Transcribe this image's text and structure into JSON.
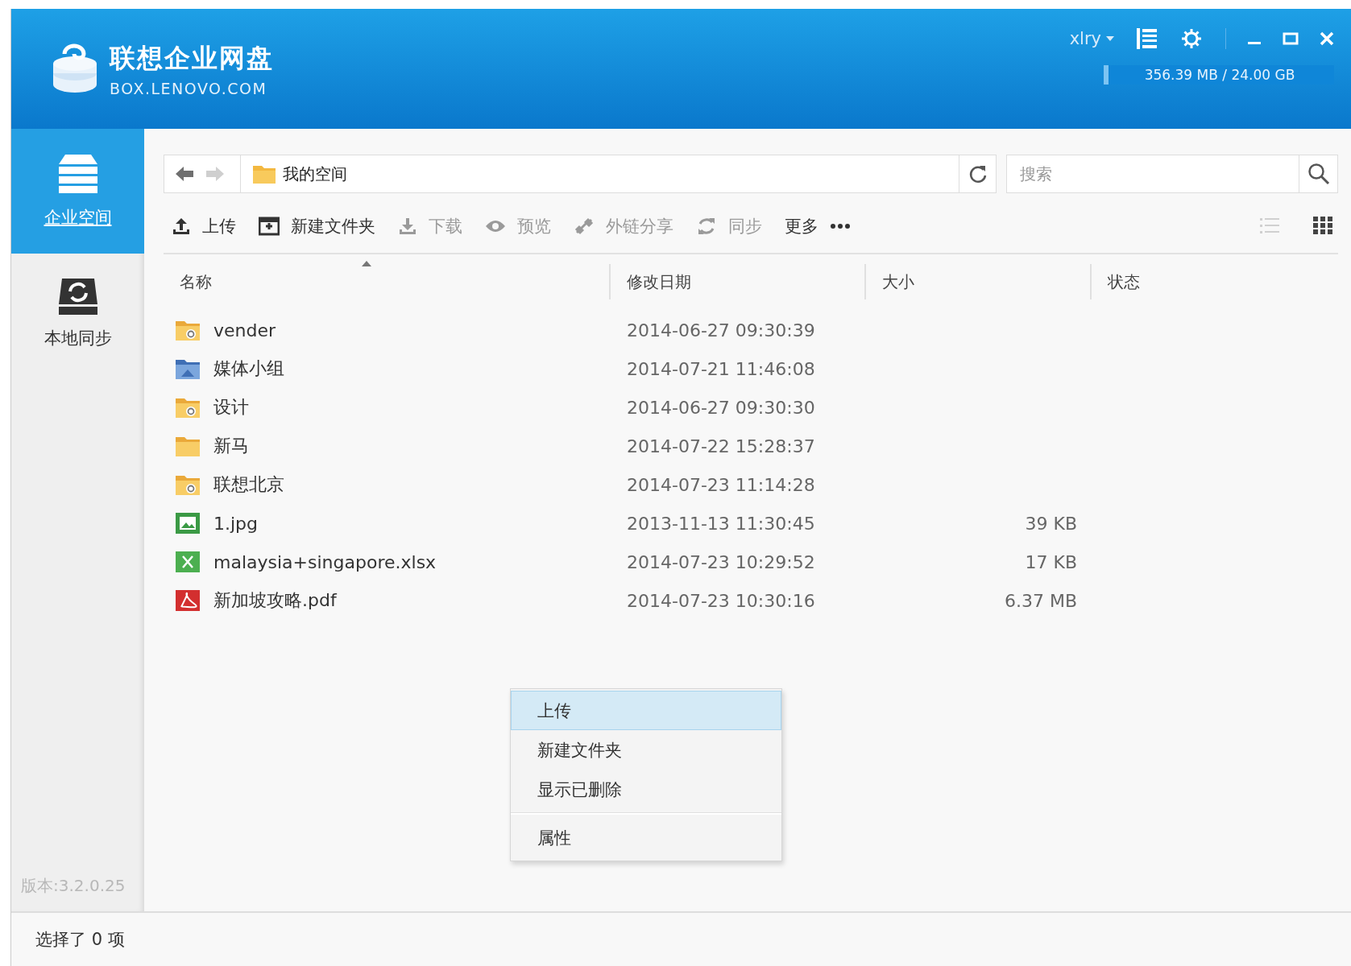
{
  "app": {
    "name": "联想企业网盘",
    "domain": "BOX.LENOVO.COM"
  },
  "user": {
    "name": "xlry"
  },
  "storage": {
    "text": "356.39 MB / 24.00 GB",
    "level": 0.015
  },
  "sidebar": {
    "items": [
      {
        "label": "企业空间",
        "kind": "server",
        "selected": true
      },
      {
        "label": "本地同步",
        "kind": "sync",
        "selected": false
      }
    ],
    "version": "版本:3.2.0.25"
  },
  "address": {
    "path": "我的空间"
  },
  "search": {
    "placeholder": "搜索"
  },
  "toolbar": [
    {
      "label": "上传",
      "kind": "upload",
      "disabled": false
    },
    {
      "label": "新建文件夹",
      "kind": "newfolder",
      "disabled": false
    },
    {
      "label": "下载",
      "kind": "download",
      "disabled": true
    },
    {
      "label": "预览",
      "kind": "preview",
      "disabled": true
    },
    {
      "label": "外链分享",
      "kind": "link",
      "disabled": true
    },
    {
      "label": "同步",
      "kind": "sync",
      "disabled": true
    },
    {
      "label": "更多",
      "kind": "more",
      "disabled": false
    }
  ],
  "views": [
    {
      "kind": "list",
      "selected": false
    },
    {
      "kind": "grid",
      "selected": true
    }
  ],
  "table": {
    "columns": [
      {
        "label": "名称",
        "sorted": true
      },
      {
        "label": "修改日期",
        "sorted": false
      },
      {
        "label": "大小",
        "sorted": false
      },
      {
        "label": "状态",
        "sorted": false
      }
    ],
    "rows": [
      {
        "name": "vender",
        "kind": "shared-folder",
        "date": "2014-06-27 09:30:39"
      },
      {
        "name": "媒体小组",
        "kind": "team-folder",
        "date": "2014-07-21 11:46:08"
      },
      {
        "name": "设计",
        "kind": "shared-folder",
        "date": "2014-06-27 09:30:30"
      },
      {
        "name": "新马",
        "kind": "folder",
        "date": "2014-07-22 15:28:37"
      },
      {
        "name": "联想北京",
        "kind": "shared-folder",
        "date": "2014-07-23 11:14:28"
      },
      {
        "name": "1.jpg",
        "kind": "image",
        "date": "2013-11-13 11:30:45",
        "size": "39 KB"
      },
      {
        "name": "malaysia+singapore.xlsx",
        "kind": "excel",
        "date": "2014-07-23 10:29:52",
        "size": "17 KB"
      },
      {
        "name": "新加坡攻略.pdf",
        "kind": "pdf",
        "date": "2014-07-23 10:30:16",
        "size": "6.37 MB"
      }
    ]
  },
  "context_menu": [
    {
      "kind": "item",
      "label": "上传",
      "selected": true
    },
    {
      "kind": "item",
      "label": "新建文件夹",
      "selected": false
    },
    {
      "kind": "item",
      "label": "显示已删除",
      "selected": false
    },
    {
      "kind": "separator"
    },
    {
      "kind": "item",
      "label": "属性",
      "selected": false
    }
  ],
  "status_bar": {
    "text": "选择了 0 项"
  }
}
